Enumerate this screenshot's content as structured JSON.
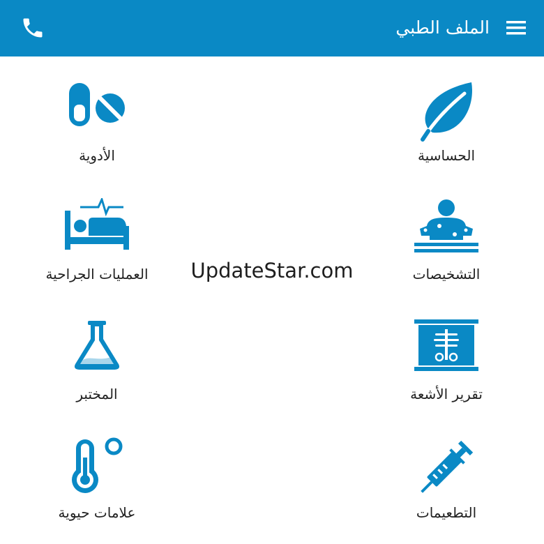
{
  "colors": {
    "appbar": "#0a89c5",
    "icon": "#0a89c5",
    "text": "#222222",
    "background": "#ffffff"
  },
  "header": {
    "title": "الملف الطبي",
    "menu_icon": "hamburger-icon",
    "call_icon": "phone-icon"
  },
  "tiles": [
    {
      "label": "الحساسية",
      "icon": "leaf-icon"
    },
    {
      "label": "الأدوية",
      "icon": "pills-icon"
    },
    {
      "label": "التشخيصات",
      "icon": "patient-diagnosis-icon"
    },
    {
      "label": "العمليات الجراحية",
      "icon": "hospital-bed-icon"
    },
    {
      "label": "تقرير الأشعة",
      "icon": "xray-icon"
    },
    {
      "label": "المختبر",
      "icon": "lab-flask-icon"
    },
    {
      "label": "التطعيمات",
      "icon": "syringe-icon"
    },
    {
      "label": "علامات حيوية",
      "icon": "thermometer-icon"
    }
  ],
  "watermark": "UpdateStar.com"
}
